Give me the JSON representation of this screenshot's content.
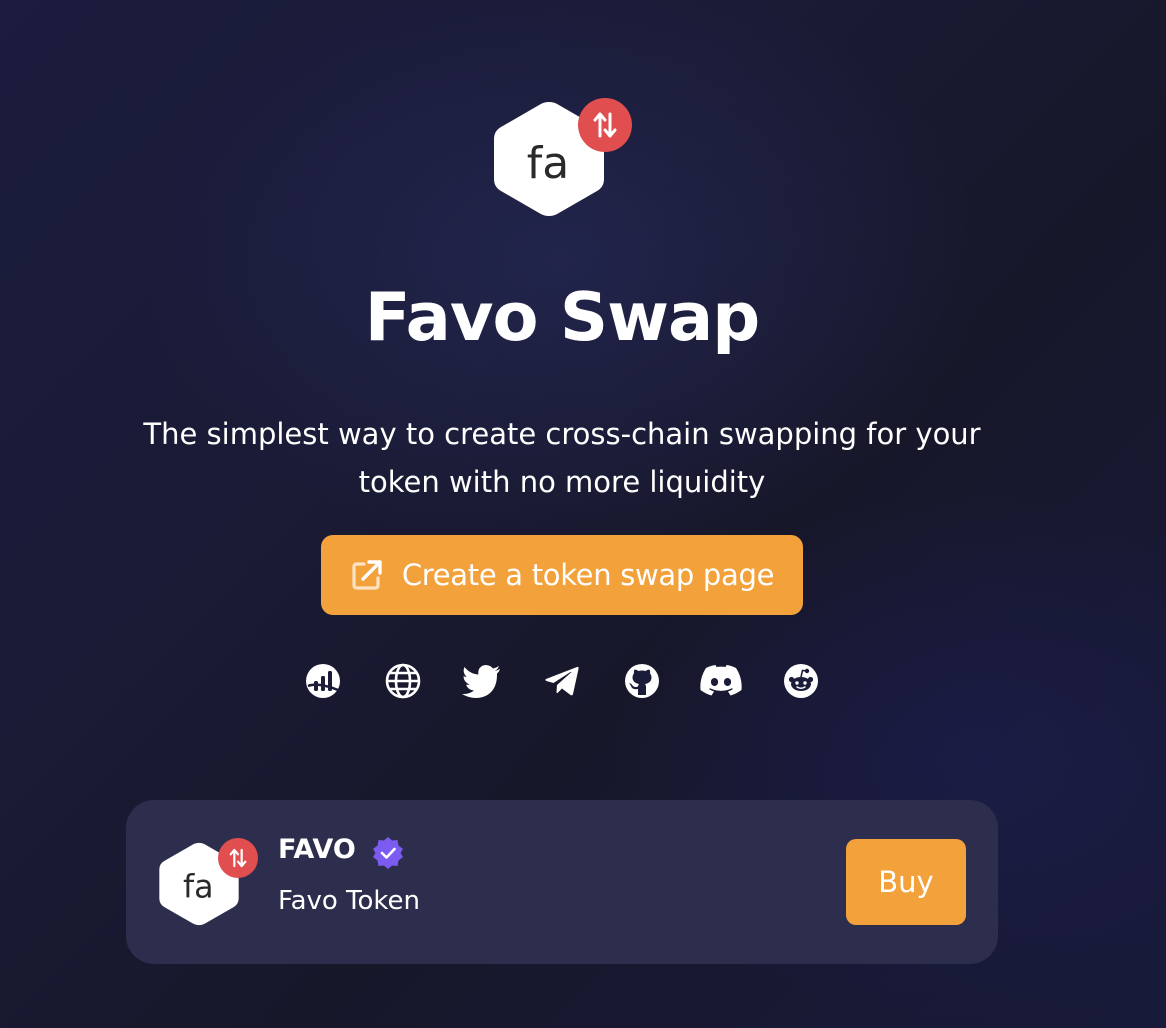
{
  "hero": {
    "title": "Favo Swap",
    "subtitle": "The simplest way to create cross-chain swapping for your token with no more liquidity",
    "logo_text": "fa",
    "logo_badge_icon": "swap-arrows-icon"
  },
  "cta": {
    "label": "Create a token swap page",
    "icon": "external-link-icon"
  },
  "social_links": [
    {
      "name": "chart-icon"
    },
    {
      "name": "globe-icon"
    },
    {
      "name": "twitter-icon"
    },
    {
      "name": "telegram-icon"
    },
    {
      "name": "github-icon"
    },
    {
      "name": "discord-icon"
    },
    {
      "name": "reddit-icon"
    }
  ],
  "token_card": {
    "symbol": "FAVO",
    "name": "Favo Token",
    "logo_text": "fa",
    "verified": true,
    "buy_label": "Buy"
  },
  "colors": {
    "accent": "#f3a13b",
    "badge": "#e04e4f",
    "verified": "#7c5cf0",
    "card_bg": "#2d2d4d",
    "page_bg": "#1a1b35"
  }
}
